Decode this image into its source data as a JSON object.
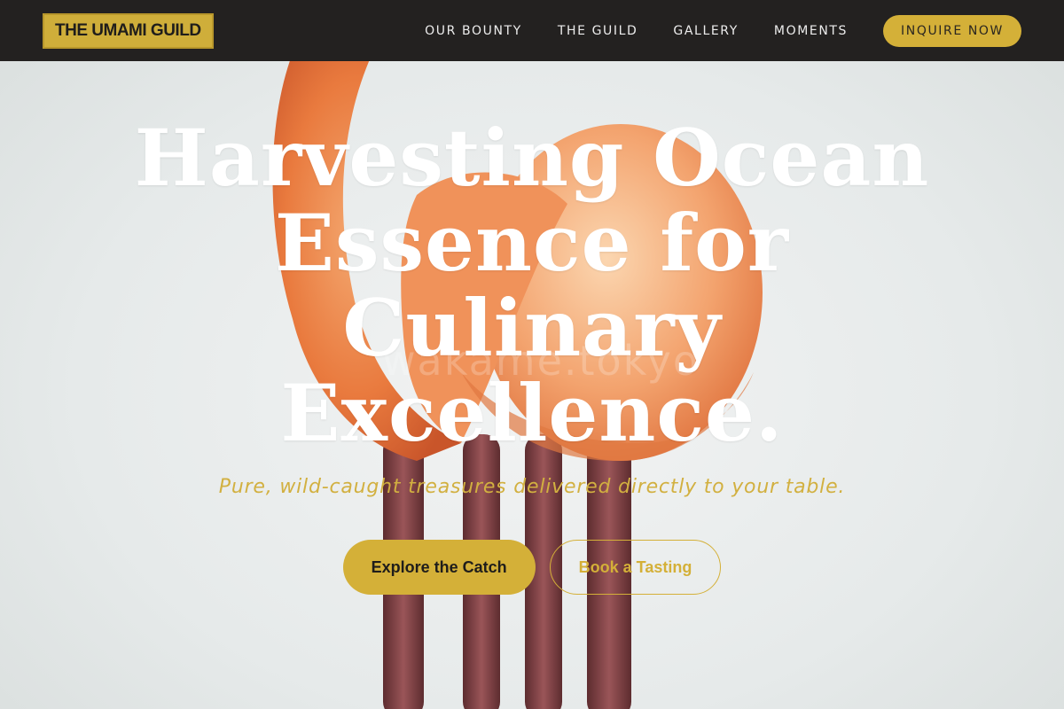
{
  "brand": {
    "logo_text": "THE UMAMI GUILD"
  },
  "nav": {
    "links": [
      "OUR BOUNTY",
      "THE GUILD",
      "GALLERY",
      "MOMENTS"
    ],
    "cta_label": "INQUIRE NOW"
  },
  "hero": {
    "headline_lines": [
      "Harvesting Ocean",
      "Essence for",
      "Culinary",
      "Excellence."
    ],
    "subtitle": "Pure, wild-caught treasures delivered directly to your table.",
    "primary_cta": "Explore the Catch",
    "secondary_cta": "Book a Tasting",
    "watermark": "wakame.tokyo"
  },
  "colors": {
    "nav_bg": "#232120",
    "accent_gold": "#d4b038",
    "hero_bg": "#e9eceb",
    "shrimp": "#e8844a",
    "fork": "#7a3c3f"
  },
  "icons": [
    "shrimp-on-fork-photo"
  ]
}
